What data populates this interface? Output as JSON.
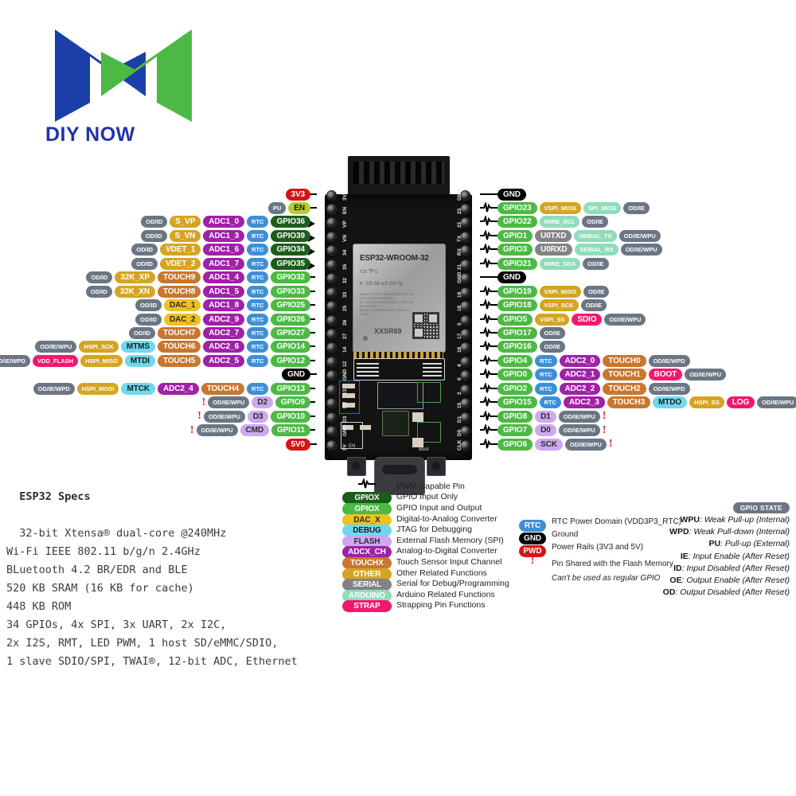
{
  "logo": {
    "text": "DIY NOW",
    "blue": "#1a3fa8",
    "green": "#4cb944"
  },
  "board": {
    "module_name": "ESP32-WROOM-32",
    "serial": "XXSR69",
    "ce_mark": "K",
    "silk_left": [
      "3V3",
      "EN",
      "VP",
      "VN",
      "34",
      "35",
      "32",
      "33",
      "25",
      "26",
      "27",
      "14",
      "12",
      "GND",
      "13",
      "D2",
      "D3",
      "GND",
      "5V"
    ],
    "silk_right": [
      "GND",
      "23",
      "22",
      "TX",
      "RX",
      "21",
      "GND",
      "19",
      "18",
      "5",
      "17",
      "16",
      "4",
      "0",
      "2",
      "15",
      "D1",
      "D0",
      "CLK"
    ],
    "button_en": "EN",
    "button_boot": "Boot"
  },
  "left_pins": [
    {
      "silk": "3V3",
      "conn": "plain",
      "tags": [
        {
          "t": "3V3",
          "c": "t-pwd"
        }
      ]
    },
    {
      "silk": "EN",
      "conn": "plain",
      "tags": [
        {
          "t": "PU",
          "c": "t-state sm"
        },
        {
          "t": "EN",
          "c": "t-en"
        }
      ]
    },
    {
      "silk": "VP",
      "conn": "arrow",
      "tags": [
        {
          "t": "OD/ID",
          "c": "t-state sm"
        },
        {
          "t": "S_VP",
          "c": "t-other"
        },
        {
          "t": "ADC1_0",
          "c": "t-adc"
        },
        {
          "t": "RTC",
          "c": "t-rtc sm"
        },
        {
          "t": "GPIO36",
          "c": "t-gpio-in"
        }
      ]
    },
    {
      "silk": "VN",
      "conn": "arrow",
      "tags": [
        {
          "t": "OD/ID",
          "c": "t-state sm"
        },
        {
          "t": "S_VN",
          "c": "t-other"
        },
        {
          "t": "ADC1_3",
          "c": "t-adc"
        },
        {
          "t": "RTC",
          "c": "t-rtc sm"
        },
        {
          "t": "GPIO39",
          "c": "t-gpio-in"
        }
      ]
    },
    {
      "silk": "34",
      "conn": "arrow",
      "tags": [
        {
          "t": "OD/ID",
          "c": "t-state sm"
        },
        {
          "t": "VDET_1",
          "c": "t-other"
        },
        {
          "t": "ADC1_6",
          "c": "t-adc"
        },
        {
          "t": "RTC",
          "c": "t-rtc sm"
        },
        {
          "t": "GPIO34",
          "c": "t-gpio-in"
        }
      ]
    },
    {
      "silk": "35",
      "conn": "arrow",
      "tags": [
        {
          "t": "OD/ID",
          "c": "t-state sm"
        },
        {
          "t": "VDET_2",
          "c": "t-other"
        },
        {
          "t": "ADC1_7",
          "c": "t-adc"
        },
        {
          "t": "RTC",
          "c": "t-rtc sm"
        },
        {
          "t": "GPIO35",
          "c": "t-gpio-in"
        }
      ]
    },
    {
      "silk": "32",
      "conn": "pwm",
      "tags": [
        {
          "t": "OD/ID",
          "c": "t-state sm"
        },
        {
          "t": "32K_XP",
          "c": "t-other"
        },
        {
          "t": "TOUCH9",
          "c": "t-touch"
        },
        {
          "t": "ADC1_4",
          "c": "t-adc"
        },
        {
          "t": "RTC",
          "c": "t-rtc sm"
        },
        {
          "t": "GPIO32",
          "c": "t-gpio-io"
        }
      ]
    },
    {
      "silk": "33",
      "conn": "pwm",
      "tags": [
        {
          "t": "OD/ID",
          "c": "t-state sm"
        },
        {
          "t": "32K_XN",
          "c": "t-other"
        },
        {
          "t": "TOUCH8",
          "c": "t-touch"
        },
        {
          "t": "ADC1_5",
          "c": "t-adc"
        },
        {
          "t": "RTC",
          "c": "t-rtc sm"
        },
        {
          "t": "GPIO33",
          "c": "t-gpio-io"
        }
      ]
    },
    {
      "silk": "25",
      "conn": "pwm",
      "tags": [
        {
          "t": "OD/ID",
          "c": "t-state sm"
        },
        {
          "t": "DAC_1",
          "c": "t-dac"
        },
        {
          "t": "ADC1_8",
          "c": "t-adc"
        },
        {
          "t": "RTC",
          "c": "t-rtc sm"
        },
        {
          "t": "GPIO25",
          "c": "t-gpio-io"
        }
      ]
    },
    {
      "silk": "26",
      "conn": "pwm",
      "tags": [
        {
          "t": "OD/ID",
          "c": "t-state sm"
        },
        {
          "t": "DAC_2",
          "c": "t-dac"
        },
        {
          "t": "ADC2_9",
          "c": "t-adc"
        },
        {
          "t": "RTC",
          "c": "t-rtc sm"
        },
        {
          "t": "GPIO26",
          "c": "t-gpio-io"
        }
      ]
    },
    {
      "silk": "27",
      "conn": "pwm",
      "tags": [
        {
          "t": "OD/ID",
          "c": "t-state sm"
        },
        {
          "t": "TOUCH7",
          "c": "t-touch"
        },
        {
          "t": "ADC2_7",
          "c": "t-adc"
        },
        {
          "t": "RTC",
          "c": "t-rtc sm"
        },
        {
          "t": "GPIO27",
          "c": "t-gpio-io"
        }
      ]
    },
    {
      "silk": "14",
      "conn": "pwm",
      "tags": [
        {
          "t": "OD/IE/WPU",
          "c": "t-state sm"
        },
        {
          "t": "HSPI_SCK",
          "c": "t-other sm"
        },
        {
          "t": "MTMS",
          "c": "t-debug"
        },
        {
          "t": "TOUCH6",
          "c": "t-touch"
        },
        {
          "t": "ADC2_6",
          "c": "t-adc"
        },
        {
          "t": "RTC",
          "c": "t-rtc sm"
        },
        {
          "t": "GPIO14",
          "c": "t-gpio-io"
        }
      ]
    },
    {
      "silk": "12",
      "conn": "pwm",
      "tags": [
        {
          "t": "OD/IE/WPD",
          "c": "t-state sm"
        },
        {
          "t": "VDD_FLASH",
          "c": "t-vddf sm"
        },
        {
          "t": "HSPI_MISO",
          "c": "t-other sm"
        },
        {
          "t": "MTDI",
          "c": "t-debug"
        },
        {
          "t": "TOUCH5",
          "c": "t-touch"
        },
        {
          "t": "ADC2_5",
          "c": "t-adc"
        },
        {
          "t": "RTC",
          "c": "t-rtc sm"
        },
        {
          "t": "GPIO12",
          "c": "t-gpio-io"
        }
      ]
    },
    {
      "silk": "GND",
      "conn": "plain",
      "tags": [
        {
          "t": "GND",
          "c": "t-gnd"
        }
      ]
    },
    {
      "silk": "13",
      "conn": "pwm",
      "tags": [
        {
          "t": "OD/IE/WPD",
          "c": "t-state sm"
        },
        {
          "t": "HSPI_MOSI",
          "c": "t-other sm"
        },
        {
          "t": "MTCK",
          "c": "t-debug"
        },
        {
          "t": "ADC2_4",
          "c": "t-adc"
        },
        {
          "t": "TOUCH4",
          "c": "t-touch"
        },
        {
          "t": "RTC",
          "c": "t-rtc sm"
        },
        {
          "t": "GPIO13",
          "c": "t-gpio-io"
        }
      ]
    },
    {
      "silk": "D2",
      "conn": "pwm",
      "warn": true,
      "tags": [
        {
          "t": "OD/IE/WPU",
          "c": "t-state sm"
        },
        {
          "t": "D2",
          "c": "t-flash"
        },
        {
          "t": "GPIO9",
          "c": "t-gpio-io"
        }
      ]
    },
    {
      "silk": "D3",
      "conn": "pwm",
      "warn": true,
      "tags": [
        {
          "t": "OD/IE/WPU",
          "c": "t-state sm"
        },
        {
          "t": "D3",
          "c": "t-flash"
        },
        {
          "t": "GPIO10",
          "c": "t-gpio-io"
        }
      ]
    },
    {
      "silk": "GND",
      "conn": "pwm",
      "warn": true,
      "tags": [
        {
          "t": "OD/IE/WPU",
          "c": "t-state sm"
        },
        {
          "t": "CMD",
          "c": "t-flash"
        },
        {
          "t": "GPIO11",
          "c": "t-gpio-io"
        }
      ]
    },
    {
      "silk": "5V",
      "conn": "plain",
      "tags": [
        {
          "t": "5V0",
          "c": "t-pwd"
        }
      ]
    }
  ],
  "right_pins": [
    {
      "silk": "GND",
      "conn": "plain",
      "tags": [
        {
          "t": "GND",
          "c": "t-gnd"
        }
      ]
    },
    {
      "silk": "23",
      "conn": "pwm",
      "tags": [
        {
          "t": "GPIO23",
          "c": "t-gpio-io"
        },
        {
          "t": "VSPI_MOSI",
          "c": "t-other sm"
        },
        {
          "t": "SPI_MOSI",
          "c": "t-arduino sm"
        },
        {
          "t": "OD/IE",
          "c": "t-state sm"
        }
      ]
    },
    {
      "silk": "22",
      "conn": "pwm",
      "tags": [
        {
          "t": "GPIO22",
          "c": "t-gpio-io"
        },
        {
          "t": "WIRE_SCL",
          "c": "t-arduino sm"
        },
        {
          "t": "OD/IE",
          "c": "t-state sm"
        }
      ]
    },
    {
      "silk": "TX",
      "conn": "pwm",
      "tags": [
        {
          "t": "GPIO1",
          "c": "t-gpio-io"
        },
        {
          "t": "U0TXD",
          "c": "t-serial"
        },
        {
          "t": "SERIAL_TX",
          "c": "t-arduino sm"
        },
        {
          "t": "OD/IE/WPU",
          "c": "t-state sm"
        }
      ]
    },
    {
      "silk": "RX",
      "conn": "pwm",
      "tags": [
        {
          "t": "GPIO3",
          "c": "t-gpio-io"
        },
        {
          "t": "U0RXD",
          "c": "t-serial"
        },
        {
          "t": "SERIAL_RX",
          "c": "t-arduino sm"
        },
        {
          "t": "OD/IE/WPU",
          "c": "t-state sm"
        }
      ]
    },
    {
      "silk": "21",
      "conn": "pwm",
      "tags": [
        {
          "t": "GPIO21",
          "c": "t-gpio-io"
        },
        {
          "t": "WIRE_SDA",
          "c": "t-arduino sm"
        },
        {
          "t": "OD/IE",
          "c": "t-state sm"
        }
      ]
    },
    {
      "silk": "GND",
      "conn": "plain",
      "tags": [
        {
          "t": "GND",
          "c": "t-gnd"
        }
      ]
    },
    {
      "silk": "19",
      "conn": "pwm",
      "tags": [
        {
          "t": "GPIO19",
          "c": "t-gpio-io"
        },
        {
          "t": "VSPI_MISO",
          "c": "t-other sm"
        },
        {
          "t": "OD/IE",
          "c": "t-state sm"
        }
      ]
    },
    {
      "silk": "18",
      "conn": "pwm",
      "tags": [
        {
          "t": "GPIO18",
          "c": "t-gpio-io"
        },
        {
          "t": "VSPI_SCK",
          "c": "t-other sm"
        },
        {
          "t": "OD/IE",
          "c": "t-state sm"
        }
      ]
    },
    {
      "silk": "5",
      "conn": "pwm",
      "tags": [
        {
          "t": "GPIO5",
          "c": "t-gpio-io"
        },
        {
          "t": "VSPI_SS",
          "c": "t-other sm"
        },
        {
          "t": "SDIO",
          "c": "t-strap"
        },
        {
          "t": "OD/IE/WPU",
          "c": "t-state sm"
        }
      ]
    },
    {
      "silk": "17",
      "conn": "pwm",
      "tags": [
        {
          "t": "GPIO17",
          "c": "t-gpio-io"
        },
        {
          "t": "OD/IE",
          "c": "t-state sm"
        }
      ]
    },
    {
      "silk": "16",
      "conn": "pwm",
      "tags": [
        {
          "t": "GPIO16",
          "c": "t-gpio-io"
        },
        {
          "t": "OD/IE",
          "c": "t-state sm"
        }
      ]
    },
    {
      "silk": "4",
      "conn": "pwm",
      "tags": [
        {
          "t": "GPIO4",
          "c": "t-gpio-io"
        },
        {
          "t": "RTC",
          "c": "t-rtc sm"
        },
        {
          "t": "ADC2_0",
          "c": "t-adc"
        },
        {
          "t": "TOUCH0",
          "c": "t-touch"
        },
        {
          "t": "OD/IE/WPD",
          "c": "t-state sm"
        }
      ]
    },
    {
      "silk": "0",
      "conn": "pwm",
      "tags": [
        {
          "t": "GPIO0",
          "c": "t-gpio-io"
        },
        {
          "t": "RTC",
          "c": "t-rtc sm"
        },
        {
          "t": "ADC2_1",
          "c": "t-adc"
        },
        {
          "t": "TOUCH1",
          "c": "t-touch"
        },
        {
          "t": "BOOT",
          "c": "t-strap"
        },
        {
          "t": "OD/IE/WPU",
          "c": "t-state sm"
        }
      ]
    },
    {
      "silk": "2",
      "conn": "pwm",
      "tags": [
        {
          "t": "GPIO2",
          "c": "t-gpio-io"
        },
        {
          "t": "RTC",
          "c": "t-rtc sm"
        },
        {
          "t": "ADC2_2",
          "c": "t-adc"
        },
        {
          "t": "TOUCH2",
          "c": "t-touch"
        },
        {
          "t": "OD/IE/WPD",
          "c": "t-state sm"
        }
      ]
    },
    {
      "silk": "15",
      "conn": "pwm",
      "tags": [
        {
          "t": "GPIO15",
          "c": "t-gpio-io"
        },
        {
          "t": "RTC",
          "c": "t-rtc sm"
        },
        {
          "t": "ADC2_3",
          "c": "t-adc"
        },
        {
          "t": "TOUCH3",
          "c": "t-touch"
        },
        {
          "t": "MTDO",
          "c": "t-debug"
        },
        {
          "t": "HSPI_SS",
          "c": "t-other sm"
        },
        {
          "t": "LOG",
          "c": "t-strap"
        },
        {
          "t": "OD/IE/WPU",
          "c": "t-state sm"
        }
      ]
    },
    {
      "silk": "D1",
      "conn": "pwm",
      "warn": true,
      "tags": [
        {
          "t": "GPIO8",
          "c": "t-gpio-io"
        },
        {
          "t": "D1",
          "c": "t-flash"
        },
        {
          "t": "OD/IE/WPU",
          "c": "t-state sm"
        }
      ]
    },
    {
      "silk": "D0",
      "conn": "pwm",
      "warn": true,
      "tags": [
        {
          "t": "GPIO7",
          "c": "t-gpio-io"
        },
        {
          "t": "D0",
          "c": "t-flash"
        },
        {
          "t": "OD/IE/WPU",
          "c": "t-state sm"
        }
      ]
    },
    {
      "silk": "CLK",
      "conn": "pwm",
      "warn": true,
      "tags": [
        {
          "t": "GPIO6",
          "c": "t-gpio-io"
        },
        {
          "t": "SCK",
          "c": "t-flash"
        },
        {
          "t": "OD/IE/WPU",
          "c": "t-state sm"
        }
      ]
    }
  ],
  "specs": {
    "title": "ESP32 Specs",
    "lines": [
      "32-bit Xtensa® dual-core @240MHz",
      "Wi-Fi IEEE 802.11 b/g/n 2.4GHz",
      "BLuetooth 4.2 BR/EDR and BLE",
      "520 KB SRAM (16 KB for cache)",
      "448 KB ROM",
      "34 GPIOs, 4x SPI, 3x UART, 2x I2C,",
      "2x I2S, RMT, LED PWM, 1 host SD/eMMC/SDIO,",
      "1 slave SDIO/SPI, TWAI®, 12-bit ADC, Ethernet"
    ]
  },
  "legend_main": [
    {
      "chip": "",
      "cls": "pwm-art",
      "desc": "PWM Capable Pin"
    },
    {
      "chip": "GPIOX",
      "cls": "t-gpio-in",
      "desc": "GPIO Input Only"
    },
    {
      "chip": "GPIOX",
      "cls": "t-gpio-io",
      "desc": "GPIO Input and Output"
    },
    {
      "chip": "DAC_X",
      "cls": "t-dac",
      "desc": "Digital-to-Analog Converter"
    },
    {
      "chip": "DEBUG",
      "cls": "t-debug",
      "desc": "JTAG for Debugging"
    },
    {
      "chip": "FLASH",
      "cls": "t-flash",
      "desc": "External Flash Memory (SPI)"
    },
    {
      "chip": "ADCX_CH",
      "cls": "t-adc",
      "desc": "Analog-to-Digital Converter"
    },
    {
      "chip": "TOUCHX",
      "cls": "t-touch",
      "desc": "Touch Sensor Input Channel"
    },
    {
      "chip": "OTHER",
      "cls": "t-other",
      "desc": "Other Related Functions"
    },
    {
      "chip": "SERIAL",
      "cls": "t-serial",
      "desc": "Serial for Debug/Programming"
    },
    {
      "chip": "ARDUINO",
      "cls": "t-arduino",
      "desc": "Arduino Related Functions"
    },
    {
      "chip": "STRAP",
      "cls": "t-strap",
      "desc": "Strapping Pin Functions"
    }
  ],
  "legend_power": [
    {
      "chip": "RTC",
      "cls": "t-rtc",
      "desc": "RTC Power Domain (VDD3P3_RTC)",
      "desc2": ""
    },
    {
      "chip": "GND",
      "cls": "t-gnd",
      "desc": "Ground",
      "desc2": ""
    },
    {
      "chip": "PWD",
      "cls": "t-pwd",
      "desc": "Power Rails (3V3 and 5V)",
      "desc2": ""
    },
    {
      "chip": "!",
      "cls": "bang",
      "desc": "Pin Shared with the Flash Memory",
      "desc2": "Can't be used as regular GPIO"
    }
  ],
  "gpio_state": {
    "badge": "GPIO STATE",
    "rows": [
      {
        "k": "WPU",
        "v": "Weak Pull-up (Internal)"
      },
      {
        "k": "WPD",
        "v": "Weak Pull-down (Internal)"
      },
      {
        "k": "PU",
        "v": "Pull-up (External)"
      },
      {
        "k": "IE",
        "v": "Input Enable (After Reset)"
      },
      {
        "k": "ID",
        "v": "Input Disabled (After Reset)"
      },
      {
        "k": "OE",
        "v": "Output Enable (After Reset)"
      },
      {
        "k": "OD",
        "v": "Output Disabled (After Reset)"
      }
    ]
  }
}
